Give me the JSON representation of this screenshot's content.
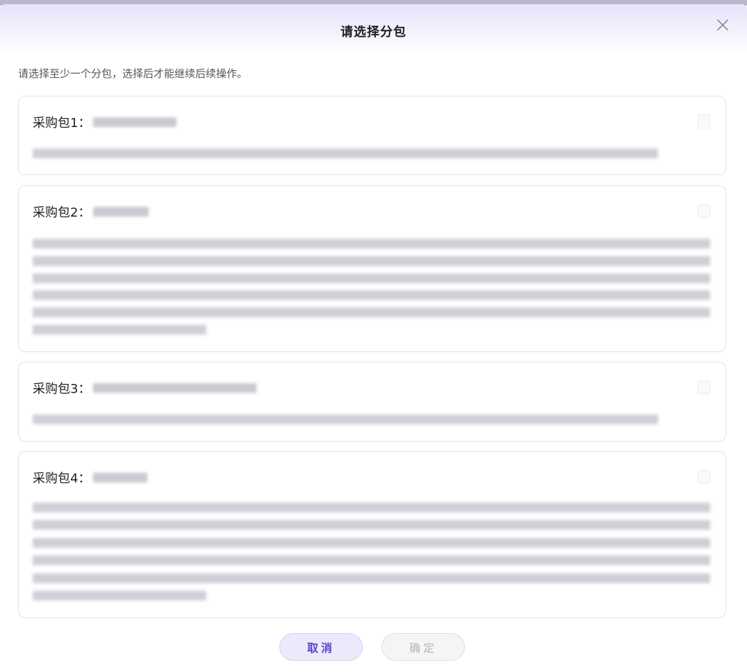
{
  "dialog": {
    "title": "请选择分包",
    "hint": "请选择至少一个分包，选择后才能继续后续操作。",
    "cancel_label": "取消",
    "confirm_label": "确定",
    "confirm_enabled": false,
    "close_icon": "close-icon"
  },
  "packages": [
    {
      "label": "采购包1：",
      "selected": false
    },
    {
      "label": "采购包2：",
      "selected": false
    },
    {
      "label": "采购包3：",
      "selected": false
    },
    {
      "label": "采购包4：",
      "selected": false
    }
  ],
  "colors": {
    "accent": "#5b3fc4",
    "header_gradient_top": "#e8e2fb",
    "cancel_bg": "#ece9fb",
    "disabled_text": "#b5b5b5"
  }
}
